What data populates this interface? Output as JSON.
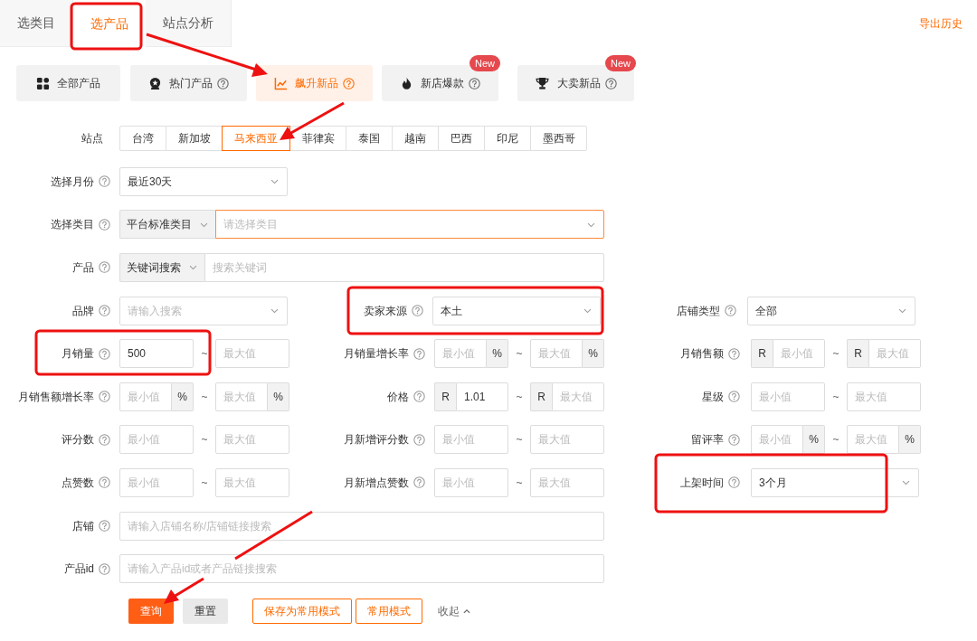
{
  "top_tabs": [
    {
      "label": "选类目",
      "selected": false
    },
    {
      "label": "选产品",
      "selected": true
    },
    {
      "label": "站点分析",
      "selected": false
    }
  ],
  "export_link": "导出历史",
  "categories": [
    {
      "label": "全部产品",
      "help": false,
      "selected": false
    },
    {
      "label": "热门产品",
      "help": true,
      "selected": false
    },
    {
      "label": "飙升新品",
      "help": true,
      "selected": true
    },
    {
      "label": "新店爆款",
      "help": true,
      "selected": false,
      "badge": "New"
    },
    {
      "label": "大卖新品",
      "help": true,
      "selected": false,
      "badge": "New"
    }
  ],
  "site": {
    "label": "站点",
    "options": [
      {
        "label": "台湾",
        "selected": false
      },
      {
        "label": "新加坡",
        "selected": false
      },
      {
        "label": "马来西亚",
        "selected": true
      },
      {
        "label": "菲律宾",
        "selected": false
      },
      {
        "label": "泰国",
        "selected": false
      },
      {
        "label": "越南",
        "selected": false
      },
      {
        "label": "巴西",
        "selected": false
      },
      {
        "label": "印尼",
        "selected": false
      },
      {
        "label": "墨西哥",
        "selected": false
      }
    ]
  },
  "rows": [
    [
      {
        "label": "选择月份",
        "help": true,
        "kind": "select",
        "value": "最近30天"
      }
    ],
    [
      {
        "label": "选择类目",
        "help": true,
        "kind": "combo",
        "prefix": "平台标准类目",
        "placeholder": "请选择类目",
        "dropdown": true,
        "focused": true
      }
    ],
    [
      {
        "label": "产品",
        "help": true,
        "kind": "combo",
        "prefix": "关键词搜索",
        "placeholder": "搜索关键词",
        "dropdown": false,
        "focused": false
      }
    ],
    [
      {
        "label": "品牌",
        "help": true,
        "kind": "select",
        "placeholder": "请输入搜索"
      },
      {
        "label": "卖家来源",
        "help": true,
        "kind": "select",
        "value": "本土"
      },
      {
        "label": "店铺类型",
        "help": true,
        "kind": "select",
        "value": "全部"
      }
    ],
    [
      {
        "label": "月销量",
        "help": true,
        "kind": "range",
        "sep": "~",
        "min": {
          "value": "500"
        },
        "max": {
          "placeholder": "最大值"
        }
      },
      {
        "label": "月销量增长率",
        "help": true,
        "kind": "range",
        "sep": "~",
        "min": {
          "placeholder": "最小值",
          "suffix": "%"
        },
        "max": {
          "placeholder": "最大值",
          "suffix": "%"
        }
      },
      {
        "label": "月销售额",
        "help": true,
        "kind": "range",
        "sep": "~",
        "min": {
          "prefix": "R",
          "placeholder": "最小值"
        },
        "max": {
          "prefix": "R",
          "placeholder": "最大值"
        }
      }
    ],
    [
      {
        "label": "月销售额增长率",
        "help": true,
        "kind": "range",
        "sep": "~",
        "min": {
          "placeholder": "最小值",
          "suffix": "%"
        },
        "max": {
          "placeholder": "最大值",
          "suffix": "%"
        }
      },
      {
        "label": "价格",
        "help": true,
        "kind": "range",
        "sep": "~",
        "min": {
          "prefix": "R",
          "value": "1.01"
        },
        "max": {
          "prefix": "R",
          "placeholder": "最大值"
        }
      },
      {
        "label": "星级",
        "help": true,
        "kind": "range",
        "sep": "~",
        "min": {
          "placeholder": "最小值"
        },
        "max": {
          "placeholder": "最大值"
        }
      }
    ],
    [
      {
        "label": "评分数",
        "help": true,
        "kind": "range",
        "sep": "~",
        "min": {
          "placeholder": "最小值"
        },
        "max": {
          "placeholder": "最大值"
        }
      },
      {
        "label": "月新增评分数",
        "help": true,
        "kind": "range",
        "sep": "~",
        "min": {
          "placeholder": "最小值"
        },
        "max": {
          "placeholder": "最大值"
        }
      },
      {
        "label": "留评率",
        "help": true,
        "kind": "range",
        "sep": "~",
        "min": {
          "placeholder": "最小值",
          "suffix": "%"
        },
        "max": {
          "placeholder": "最大值",
          "suffix": "%"
        }
      }
    ],
    [
      {
        "label": "点赞数",
        "help": true,
        "kind": "range",
        "sep": "~",
        "min": {
          "placeholder": "最小值"
        },
        "max": {
          "placeholder": "最大值"
        }
      },
      {
        "label": "月新增点赞数",
        "help": true,
        "kind": "range",
        "sep": "~",
        "min": {
          "placeholder": "最小值"
        },
        "max": {
          "placeholder": "最大值"
        }
      },
      {
        "label": "上架时间",
        "help": true,
        "kind": "select",
        "value": "3个月"
      }
    ],
    [
      {
        "label": "店铺",
        "help": true,
        "kind": "text",
        "placeholder": "请输入店铺名称/店铺链接搜索"
      }
    ],
    [
      {
        "label": "产品id",
        "help": true,
        "kind": "text",
        "placeholder": "请输入产品id或者产品链接搜索"
      }
    ]
  ],
  "actions": [
    {
      "label": "查询",
      "kind": "primary"
    },
    {
      "label": "重置",
      "kind": "secondary"
    },
    {
      "label": "保存为常用模式",
      "kind": "outline"
    },
    {
      "label": "常用模式",
      "kind": "outline"
    },
    {
      "label": "收起",
      "kind": "link"
    }
  ]
}
